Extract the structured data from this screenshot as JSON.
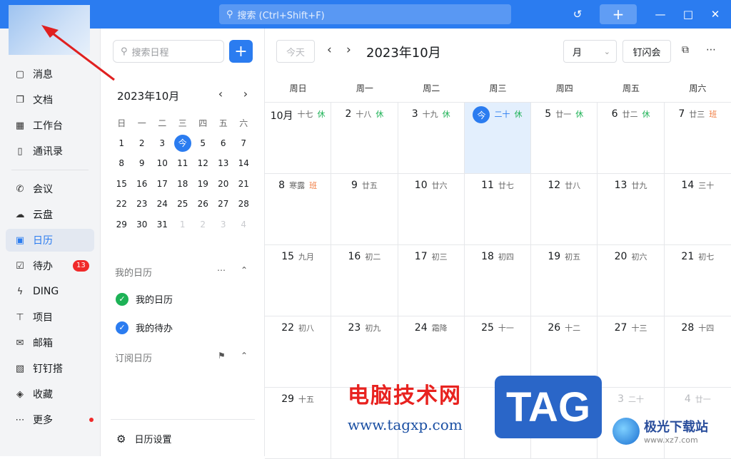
{
  "titlebar": {
    "search_placeholder": "搜索 (Ctrl+Shift+F)",
    "icons": [
      "history-icon",
      "plus-icon",
      "minimize-icon",
      "maximize-icon",
      "close-icon"
    ],
    "accent": "#2b7cf0"
  },
  "sidebar": {
    "items": [
      {
        "label": "消息",
        "icon": "message-icon"
      },
      {
        "label": "文档",
        "icon": "document-icon"
      },
      {
        "label": "工作台",
        "icon": "grid-icon"
      },
      {
        "label": "通讯录",
        "icon": "contacts-icon"
      },
      {
        "label": "会议",
        "icon": "phone-icon"
      },
      {
        "label": "云盘",
        "icon": "cloud-icon"
      },
      {
        "label": "日历",
        "icon": "calendar-icon",
        "active": true
      },
      {
        "label": "待办",
        "icon": "todo-icon",
        "badge": "13"
      },
      {
        "label": "DING",
        "icon": "lightning-icon"
      },
      {
        "label": "项目",
        "icon": "project-icon"
      },
      {
        "label": "邮箱",
        "icon": "mail-icon"
      },
      {
        "label": "钉钉搭",
        "icon": "build-icon"
      },
      {
        "label": "收藏",
        "icon": "favorite-icon"
      },
      {
        "label": "更多",
        "icon": "more-icon"
      }
    ]
  },
  "panel": {
    "search_placeholder": "搜索日程",
    "mini_month": "2023年10月",
    "weekdays": [
      "日",
      "一",
      "二",
      "三",
      "四",
      "五",
      "六"
    ],
    "weeks": [
      [
        "1",
        "2",
        "3",
        "今",
        "5",
        "6",
        "7"
      ],
      [
        "8",
        "9",
        "10",
        "11",
        "12",
        "13",
        "14"
      ],
      [
        "15",
        "16",
        "17",
        "18",
        "19",
        "20",
        "21"
      ],
      [
        "22",
        "23",
        "24",
        "25",
        "26",
        "27",
        "28"
      ],
      [
        "29",
        "30",
        "31",
        "1",
        "2",
        "3",
        "4"
      ]
    ],
    "my_calendars_title": "我的日历",
    "my_calendars": [
      {
        "label": "我的日历",
        "color": "#1db256"
      },
      {
        "label": "我的待办",
        "color": "#2b7cf0"
      }
    ],
    "subscribed_title": "订阅日历",
    "settings_label": "日历设置"
  },
  "main": {
    "today_button": "今天",
    "month_heading": "2023年10月",
    "view_select": "月",
    "flash_meeting": "钉闪会",
    "weekdays": [
      "周日",
      "周一",
      "周二",
      "周三",
      "周四",
      "周五",
      "周六"
    ],
    "weeks": [
      [
        {
          "num": "10月",
          "lunar": "十七",
          "tag": "休",
          "tagType": "rest"
        },
        {
          "num": "2",
          "lunar": "十八",
          "tag": "休",
          "tagType": "rest"
        },
        {
          "num": "3",
          "lunar": "十九",
          "tag": "休",
          "tagType": "rest"
        },
        {
          "num": "今",
          "lunar": "二十",
          "tag": "休",
          "tagType": "rest",
          "today": true
        },
        {
          "num": "5",
          "lunar": "廿一",
          "tag": "休",
          "tagType": "rest"
        },
        {
          "num": "6",
          "lunar": "廿二",
          "tag": "休",
          "tagType": "rest"
        },
        {
          "num": "7",
          "lunar": "廿三",
          "tag": "班",
          "tagType": "work"
        }
      ],
      [
        {
          "num": "8",
          "lunar": "寒露",
          "tag": "班",
          "tagType": "work"
        },
        {
          "num": "9",
          "lunar": "廿五"
        },
        {
          "num": "10",
          "lunar": "廿六"
        },
        {
          "num": "11",
          "lunar": "廿七"
        },
        {
          "num": "12",
          "lunar": "廿八"
        },
        {
          "num": "13",
          "lunar": "廿九"
        },
        {
          "num": "14",
          "lunar": "三十"
        }
      ],
      [
        {
          "num": "15",
          "lunar": "九月"
        },
        {
          "num": "16",
          "lunar": "初二"
        },
        {
          "num": "17",
          "lunar": "初三"
        },
        {
          "num": "18",
          "lunar": "初四"
        },
        {
          "num": "19",
          "lunar": "初五"
        },
        {
          "num": "20",
          "lunar": "初六"
        },
        {
          "num": "21",
          "lunar": "初七"
        }
      ],
      [
        {
          "num": "22",
          "lunar": "初八"
        },
        {
          "num": "23",
          "lunar": "初九"
        },
        {
          "num": "24",
          "lunar": "霜降"
        },
        {
          "num": "25",
          "lunar": "十一"
        },
        {
          "num": "26",
          "lunar": "十二"
        },
        {
          "num": "27",
          "lunar": "十三"
        },
        {
          "num": "28",
          "lunar": "十四"
        }
      ],
      [
        {
          "num": "29",
          "lunar": "十五"
        },
        {
          "num": "",
          "lunar": ""
        },
        {
          "num": "",
          "lunar": ""
        },
        {
          "num": "",
          "lunar": ""
        },
        {
          "num": "",
          "lunar": ""
        },
        {
          "num": "3",
          "lunar": "二十",
          "dim": true
        },
        {
          "num": "4",
          "lunar": "廿一",
          "dim": true
        }
      ]
    ]
  },
  "watermark": {
    "site_cn": "电脑技术网",
    "site_url": "www.tagxp.com",
    "tag_logo": "TAG",
    "xz_name": "极光下载站",
    "xz_url": "www.xz7.com"
  }
}
